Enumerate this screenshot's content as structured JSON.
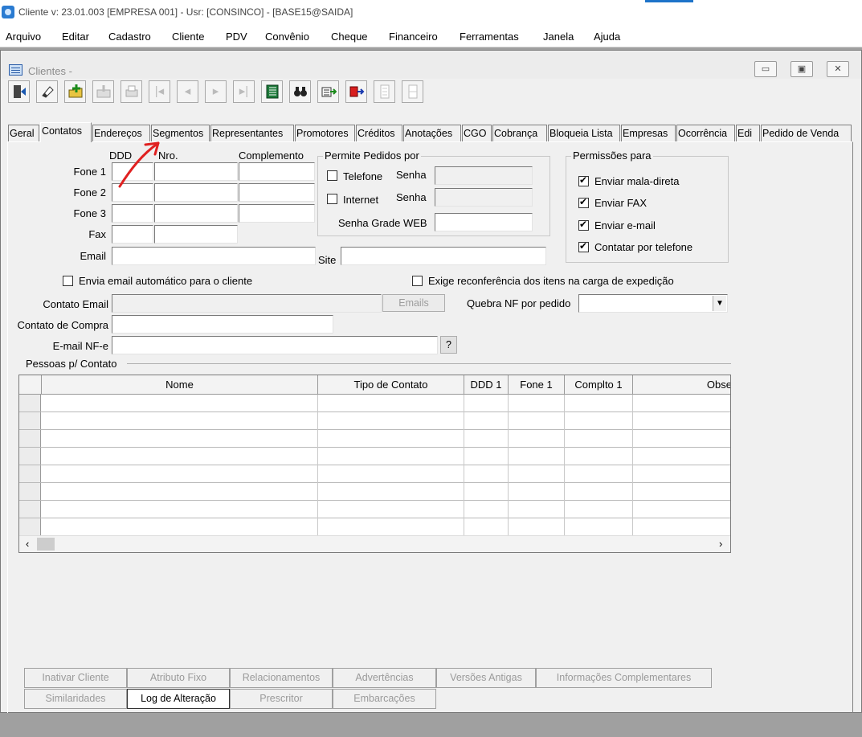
{
  "titlebar": {
    "title": "Cliente  v: 23.01.003   [EMPRESA 001] - Usr: [CONSINCO] - [BASE15@SAIDA]"
  },
  "menu": [
    "Arquivo",
    "Editar",
    "Cadastro",
    "Cliente",
    "PDV",
    "Convênio",
    "Cheque",
    "Financeiro",
    "Ferramentas",
    "Janela",
    "Ajuda"
  ],
  "window": {
    "title": "Clientes -",
    "minimize": "▭",
    "restore": "▣",
    "close": "✕"
  },
  "toolbar": [
    "exit-icon",
    "eraser-icon",
    "new-folder-icon",
    "save-icon",
    "print-icon",
    "first-icon",
    "prev-icon",
    "next-icon",
    "last-icon",
    "list-icon",
    "binoculars-icon",
    "import-icon",
    "export-icon",
    "checklist-icon",
    "grid-icon"
  ],
  "tabs": [
    "Geral",
    "Contatos",
    "Endereços",
    "Segmentos",
    "Representantes",
    "Promotores",
    "Créditos",
    "Anotações",
    "CGO",
    "Cobrança",
    "Bloqueia Lista",
    "Empresas",
    "Ocorrência",
    "Edi",
    "Pedido de Venda"
  ],
  "active_tab": "Contatos",
  "phones": {
    "col_ddd": "DDD",
    "col_nro": "Nro.",
    "col_complemento": "Complemento",
    "rows": [
      "Fone 1",
      "Fone 2",
      "Fone 3",
      "Fax"
    ],
    "email_label": "Email",
    "site_label": "Site"
  },
  "permite_pedidos": {
    "title": "Permite Pedidos por",
    "telefone": "Telefone",
    "internet": "Internet",
    "senha": "Senha",
    "senha_grade": "Senha Grade WEB"
  },
  "permissoes": {
    "title": "Permissões para",
    "items": [
      "Enviar mala-direta",
      "Enviar FAX",
      "Enviar e-mail",
      "Contatar por telefone"
    ]
  },
  "envia_email_auto": "Envia email automático para o cliente",
  "exige_reconferencia": "Exige reconferência dos itens na carga de expedição",
  "contato_email": {
    "label": "Contato Email",
    "button": "Emails"
  },
  "quebra_nf": {
    "label": "Quebra NF por pedido",
    "value": ""
  },
  "contato_compra": {
    "label": "Contato de Compra"
  },
  "email_nfe": {
    "label": "E-mail NF-e",
    "button": "?"
  },
  "pessoas": {
    "title": "Pessoas p/ Contato",
    "columns": [
      "Nome",
      "Tipo de Contato",
      "DDD 1",
      "Fone 1",
      "Complto 1",
      "Obse"
    ]
  },
  "bottom_buttons": {
    "row1": [
      "Inativar Cliente",
      "Atributo Fixo",
      "Relacionamentos",
      "Advertências",
      "Versões Antigas",
      "Informações Complementares"
    ],
    "row2": [
      "Similaridades",
      "Log de Alteração",
      "Prescritor",
      "Embarcações"
    ]
  },
  "colors": {
    "annotation_arrow": "#e02020",
    "accent": "#1d73c9"
  }
}
